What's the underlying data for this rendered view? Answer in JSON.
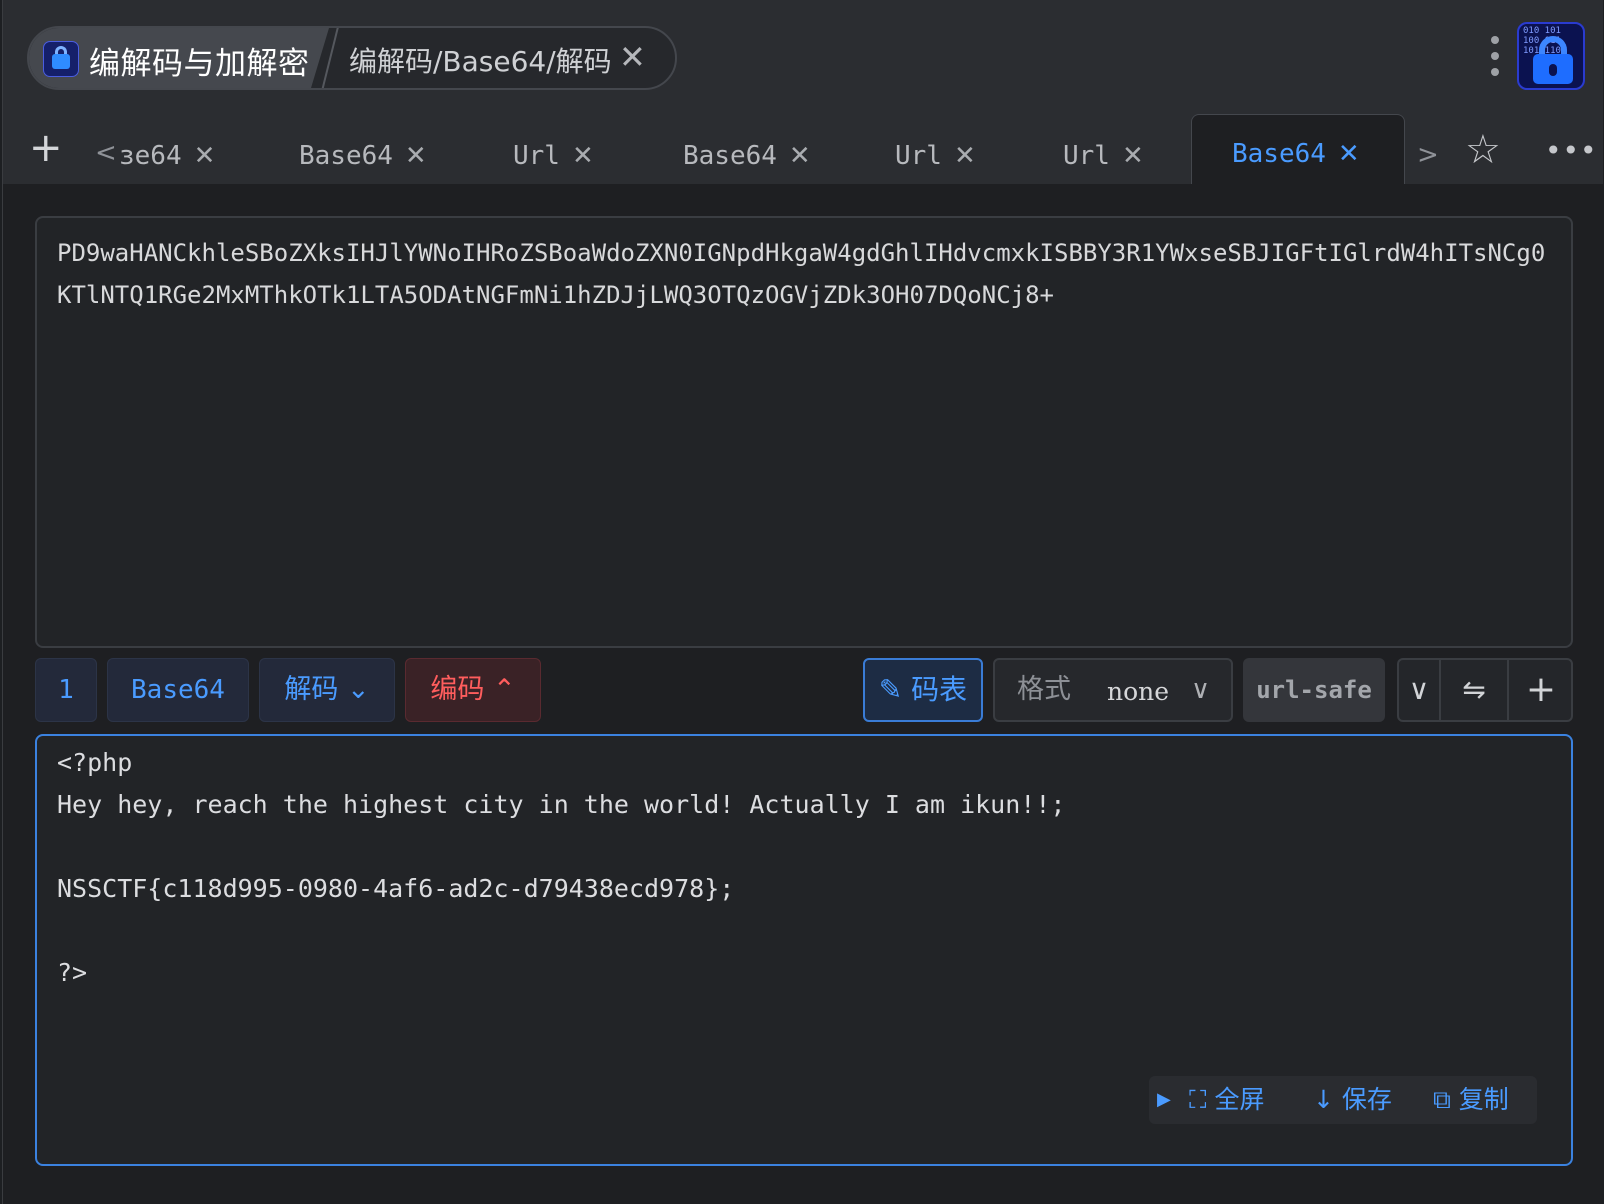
{
  "app": {
    "title": "编解码与加解密",
    "breadcrumb": "编解码/Base64/解码",
    "close_glyph": "✕",
    "logo_bits": "010 101\n100 011\n101 110"
  },
  "tabs": {
    "first_partial": "ɜe64",
    "items": [
      {
        "label": "Base64"
      },
      {
        "label": "Url"
      },
      {
        "label": "Base64"
      },
      {
        "label": "Url"
      },
      {
        "label": "Url"
      },
      {
        "label": "Base64",
        "active": true
      }
    ]
  },
  "input": {
    "text": "PD9waHANCkhleSBoZXksIHJlYWNoIHRoZSBoaWdoZXN0IGNpdHkgaW4gdGhlIHdvcmxkISBBY3R1YWxseSBJIGFtIGlrdW4hITsNCg0KTlNTQ1RGe2MxMThkOTk1LTA5ODAtNGFmNi1hZDJjLWQ3OTQzOGVjZDk3OH07DQoNCj8+"
  },
  "toolbar": {
    "step": "1",
    "name": "Base64",
    "decode": "解码",
    "encode": "编码",
    "table": "码表",
    "format_label": "格式",
    "format_value": "none",
    "url_safe": "url-safe"
  },
  "output": {
    "lines": [
      "<?php",
      "Hey hey, reach the highest city in the world! Actually I am ikun!!;",
      "",
      "NSSCTF{c118d995-0980-4af6-ad2c-d79438ecd978};",
      "",
      "?>"
    ],
    "fullscreen": "全屏",
    "save": "保存",
    "copy": "复制"
  },
  "colors": {
    "accent": "#4a9bff",
    "danger": "#ff5d5d",
    "background": "#1e1f22"
  }
}
